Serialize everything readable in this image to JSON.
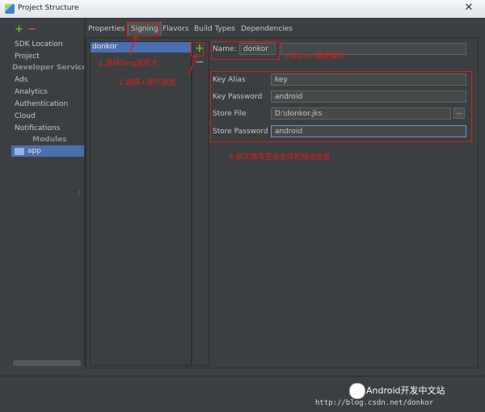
{
  "window": {
    "title": "Project Structure"
  },
  "sidebar": {
    "items": [
      {
        "label": "SDK Location"
      },
      {
        "label": "Project"
      }
    ],
    "developer_services_header": "Developer Services",
    "services": [
      {
        "label": "Ads"
      },
      {
        "label": "Analytics"
      },
      {
        "label": "Authentication"
      },
      {
        "label": "Cloud"
      },
      {
        "label": "Notifications"
      }
    ],
    "modules_header": "Modules",
    "modules": [
      {
        "label": "app"
      }
    ]
  },
  "tabs": [
    {
      "label": "Properties"
    },
    {
      "label": "Signing"
    },
    {
      "label": "Flavors"
    },
    {
      "label": "Build Types"
    },
    {
      "label": "Dependencies"
    }
  ],
  "signing_list": {
    "items": [
      {
        "label": "donkor"
      }
    ]
  },
  "form": {
    "name": {
      "label": "Name:",
      "value": "donkor"
    },
    "key_alias": {
      "label": "Key Alias",
      "value": "key"
    },
    "key_password": {
      "label": "Key Password",
      "value": "android"
    },
    "store_file": {
      "label": "Store File",
      "value": "D:\\donkor.jks",
      "browse_label": "..."
    },
    "store_password": {
      "label": "Store Password",
      "value": "android"
    }
  },
  "annotations": {
    "step1": "1.选择Sing选项卡",
    "step2": "2.选择+进行添加",
    "step3": "3.Name:随便填写",
    "step4": "4.依次填写签名文件的相关信息"
  },
  "watermark": {
    "brand": "Android开发中文站",
    "url": "http://blog.csdn.net/donkor"
  },
  "colors": {
    "accent": "#4b6eaf",
    "annotation": "#d21f1f",
    "add_icon": "#5bc232",
    "remove_icon": "#d24b4b"
  }
}
